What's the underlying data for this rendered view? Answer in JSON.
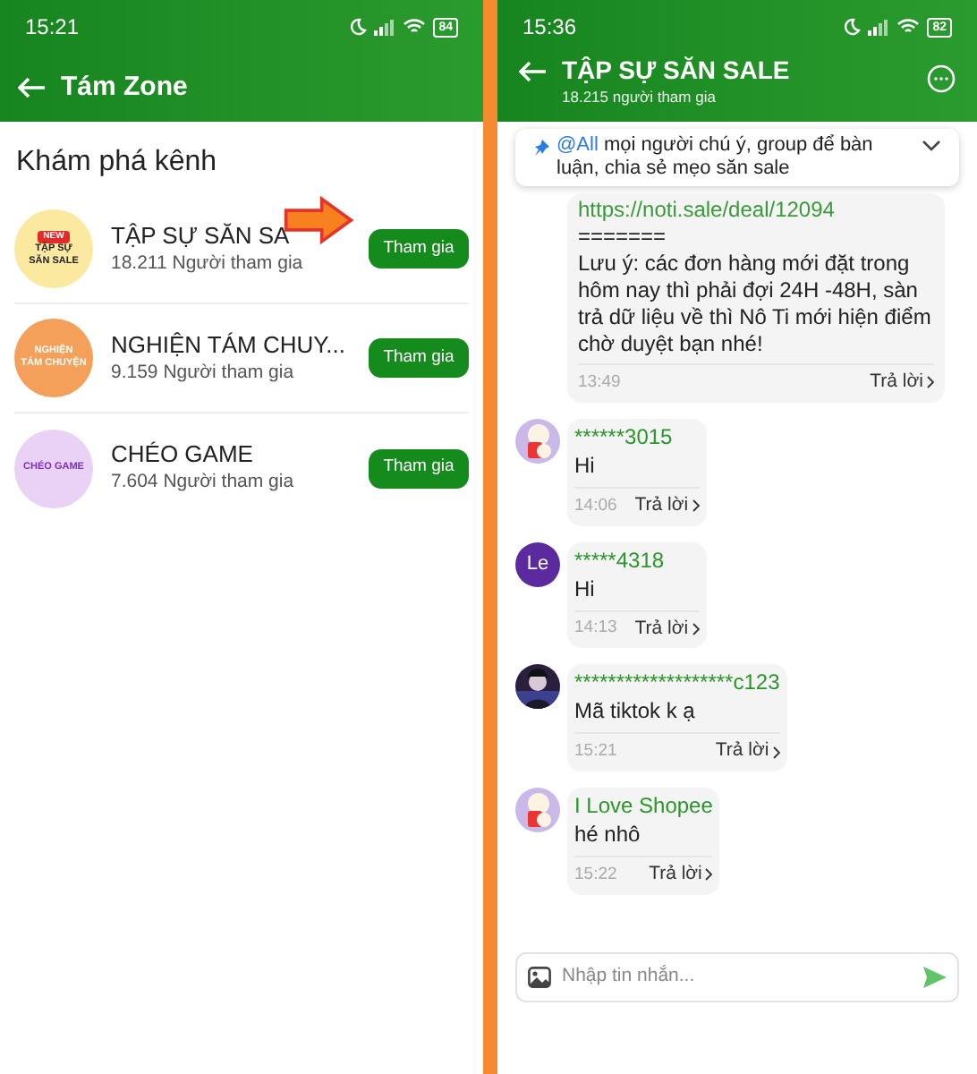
{
  "left_screen": {
    "status_bar": {
      "time": "15:21",
      "battery": "84"
    },
    "header": {
      "title": "Tám Zone"
    },
    "section_title": "Khám phá kênh",
    "channels": [
      {
        "name": "TẬP SỰ SĂN SA",
        "members": "18.211 Người tham gia",
        "button": "Tham gia",
        "logo": {
          "color": "#fbe9a0",
          "badge": "NEW",
          "lines": [
            "TẬP SỰ",
            "SĂN SALE"
          ]
        }
      },
      {
        "name": "NGHIỆN TÁM CHUY...",
        "members": "9.159 Người tham gia",
        "button": "Tham gia",
        "logo": {
          "color": "#f4a05a",
          "lines": [
            "NGHIỆN",
            "TÁM CHUYỆN"
          ]
        }
      },
      {
        "name": "CHÉO GAME",
        "members": "7.604 Người tham gia",
        "button": "Tham gia",
        "logo": {
          "color": "#e9d2f5",
          "lines": [
            "CHÉO GAME"
          ]
        }
      }
    ]
  },
  "right_screen": {
    "status_bar": {
      "time": "15:36",
      "battery": "82"
    },
    "header": {
      "title": "TẬP SỰ SĂN SALE",
      "subtitle": "18.215 người tham gia"
    },
    "pinned": {
      "mention": "@All",
      "text": "mọi người chú ý, group để bàn luận, chia sẻ mẹo săn sale"
    },
    "messages": [
      {
        "kind": "post",
        "link": "https://noti.sale/deal/12094",
        "lines": [
          "=======",
          "Lưu ý: các đơn hàng mới đặt trong hôm nay thì phải đợi 24H -48H, sàn trả dữ liệu về thì Nô Ti mới hiện điểm chờ duyệt bạn nhé!"
        ],
        "time": "13:49",
        "reply": "Trả lời"
      },
      {
        "kind": "chat",
        "avatar": {
          "kind": "cartoon"
        },
        "sender": "******3015",
        "text": "Hi",
        "time": "14:06",
        "reply": "Trả lời"
      },
      {
        "kind": "chat",
        "avatar": {
          "kind": "letter",
          "text": "Le"
        },
        "sender": "*****4318",
        "text": "Hi",
        "time": "14:13",
        "reply": "Trả lời"
      },
      {
        "kind": "chat",
        "sender": "*******************c123",
        "text": "Mã tiktok k ạ",
        "time": "15:21",
        "reply": "Trả lời"
      },
      {
        "kind": "chat",
        "avatar": {
          "kind": "cartoon"
        },
        "sender": "I Love Shopee",
        "text": "hé nhô",
        "time": "15:22",
        "reply": "Trả lời"
      }
    ],
    "composer": {
      "placeholder": "Nhập tin nhắn..."
    }
  }
}
